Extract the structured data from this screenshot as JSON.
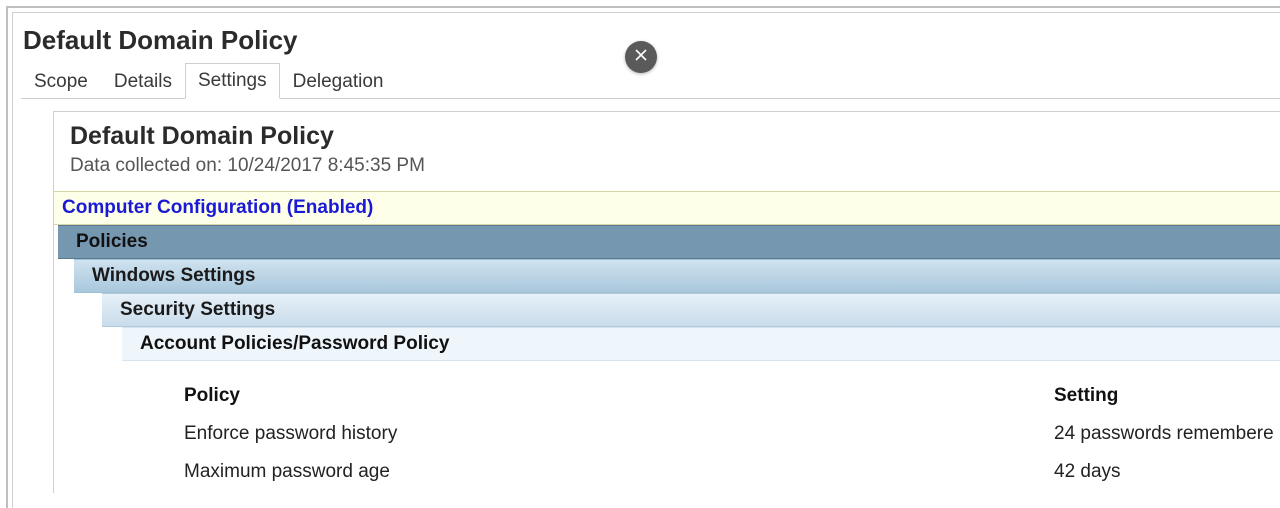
{
  "title": "Default Domain Policy",
  "tabs": [
    {
      "label": "Scope"
    },
    {
      "label": "Details"
    },
    {
      "label": "Settings",
      "active": true
    },
    {
      "label": "Delegation"
    }
  ],
  "report": {
    "title": "Default Domain Policy",
    "collected_label": "Data collected on: 10/24/2017 8:45:35 PM"
  },
  "sections": {
    "computer_config": "Computer Configuration (Enabled)",
    "policies": "Policies",
    "windows_settings": "Windows Settings",
    "security_settings": "Security Settings",
    "account_policies": "Account Policies/Password Policy"
  },
  "table": {
    "header_policy": "Policy",
    "header_setting": "Setting",
    "rows": [
      {
        "policy": "Enforce password history",
        "setting": "24 passwords remembere"
      },
      {
        "policy": "Maximum password age",
        "setting": "42 days"
      }
    ]
  },
  "close_icon": "close"
}
